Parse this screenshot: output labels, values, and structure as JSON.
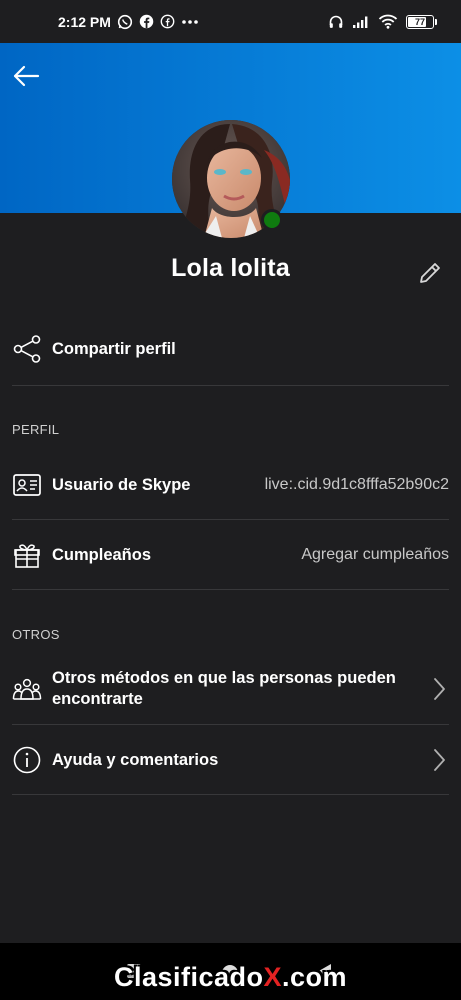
{
  "status_bar": {
    "time": "2:12 PM",
    "battery": "77",
    "battery_level": 0.77,
    "icons": [
      "whatsapp-icon",
      "facebook-icon",
      "facebook-icon",
      "more-dots-icon",
      "headphones-icon",
      "signal-icon",
      "wifi-icon",
      "battery-icon"
    ]
  },
  "colors": {
    "banner_start": "#0066c4",
    "banner_end": "#0c8fe6",
    "background": "#1e1e20",
    "presence": "#0f7b0f",
    "divider": "#38383a",
    "watermark_accent": "#e32222"
  },
  "profile": {
    "name": "Lola lolita",
    "status": "online"
  },
  "share": {
    "label": "Compartir perfil",
    "icon": "share-icon"
  },
  "sections": {
    "perfil": "PERFIL",
    "otros": "OTROS"
  },
  "skype_user": {
    "label": "Usuario de Skype",
    "value": "live:.cid.9d1c8fffa52b90c2",
    "icon": "id-card-icon"
  },
  "birthday": {
    "label": "Cumpleaños",
    "value": "Agregar cumpleaños",
    "icon": "gift-icon"
  },
  "other_methods": {
    "label": "Otros métodos en que las personas pueden encontrarte",
    "icon": "people-icon"
  },
  "help": {
    "label": "Ayuda y comentarios",
    "icon": "info-icon"
  },
  "watermark": {
    "pre": "Clasificado",
    "accent": "X",
    "post": ".com"
  }
}
